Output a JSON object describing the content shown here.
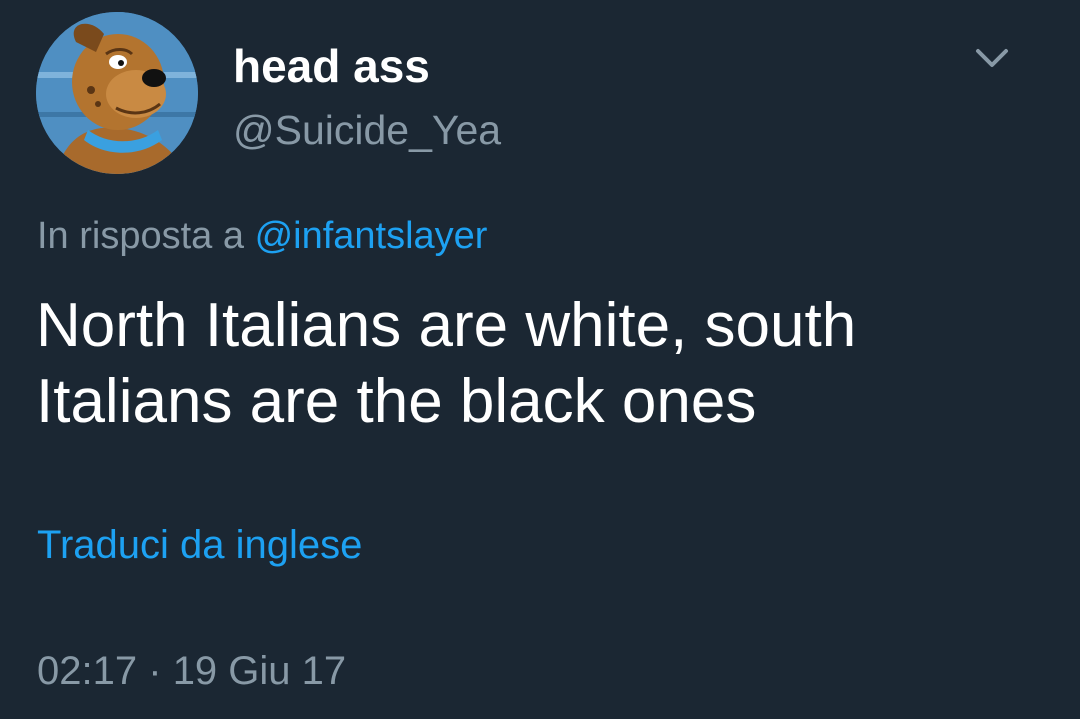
{
  "tweet": {
    "author": {
      "display_name": "head ass",
      "handle": "@Suicide_Yea",
      "avatar_icon": "cartoon-dog-avatar"
    },
    "menu_icon": "chevron-down-icon",
    "reply_prefix": "In risposta a",
    "reply_to": "@infantslayer",
    "text": "North Italians are white, south\nItalians are the black ones",
    "translate_label": "Traduci da inglese",
    "time": "02:17",
    "separator": "·",
    "date": "19 Giu 17"
  },
  "colors": {
    "background": "#1b2733",
    "text": "#ffffff",
    "secondary": "#8899a6",
    "link": "#1da1f2"
  }
}
